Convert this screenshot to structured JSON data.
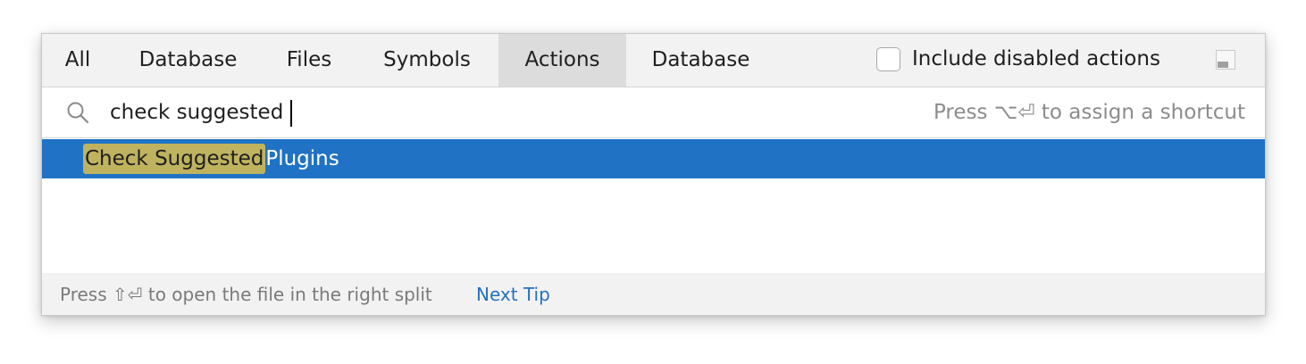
{
  "tabs": [
    {
      "label": "All",
      "selected": false
    },
    {
      "label": "Database",
      "selected": false
    },
    {
      "label": "Files",
      "selected": false
    },
    {
      "label": "Symbols",
      "selected": false
    },
    {
      "label": "Actions",
      "selected": true
    },
    {
      "label": "Database",
      "selected": false
    }
  ],
  "include_disabled": {
    "label": "Include disabled actions",
    "checked": false
  },
  "search": {
    "value": "check suggested",
    "hint": "Press ⌥⏎ to assign a shortcut",
    "icon": "search-icon"
  },
  "results": [
    {
      "match": "Check Suggested",
      "rest": "Plugins",
      "selected": true
    }
  ],
  "footer": {
    "hint": "Press ⇧⏎ to open the file in the right split",
    "next_tip": "Next Tip"
  },
  "colors": {
    "selection": "#2072c4",
    "match_highlight": "#bfb35f",
    "link": "#2470c2",
    "tab_selected": "#dcdcdc"
  }
}
